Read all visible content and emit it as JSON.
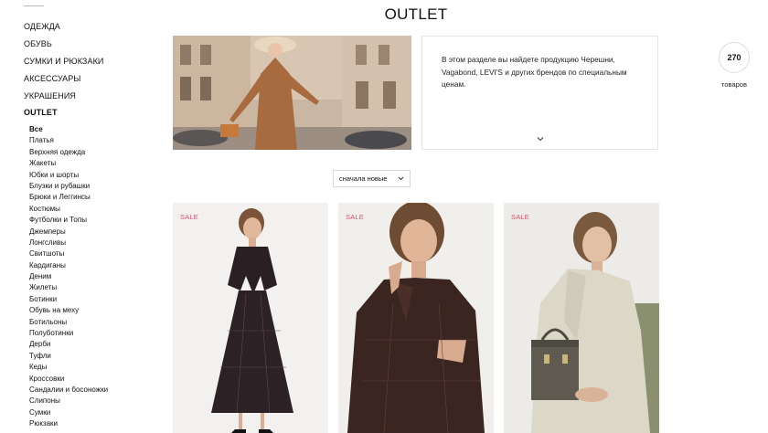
{
  "sidebar": {
    "categories": [
      {
        "label": "ОДЕЖДА"
      },
      {
        "label": "ОБУВЬ"
      },
      {
        "label": "СУМКИ И РЮКЗАКИ"
      },
      {
        "label": "АКСЕССУАРЫ"
      },
      {
        "label": "УКРАШЕНИЯ"
      },
      {
        "label": "OUTLET"
      }
    ],
    "subcategories": [
      "Все",
      "Платья",
      "Верхняя одежда",
      "Жакеты",
      "Юбки и шорты",
      "Блузки и рубашки",
      "Брюки и Леггинсы",
      "Костюмы",
      "Футболки и Топы",
      "Джемперы",
      "Лонгсливы",
      "Свитшоты",
      "Кардиганы",
      "Деним",
      "Жилеты",
      "Ботинки",
      "Обувь на меху",
      "Ботильоны",
      "Полуботинки",
      "Дерби",
      "Туфли",
      "Кеды",
      "Кроссовки",
      "Сандалии и босоножки",
      "Слипоны",
      "Сумки",
      "Рюкзаки"
    ]
  },
  "page": {
    "title": "OUTLET",
    "description": "В этом разделе вы найдете продукцию Черешни, Vagabond, LEVI'S и других брендов по специальным ценам.",
    "count": "270",
    "count_label": "товаров"
  },
  "sort": {
    "selected": "сначала новые"
  },
  "products": [
    {
      "badge": "SALE"
    },
    {
      "badge": "SALE"
    },
    {
      "badge": "SALE"
    }
  ],
  "colors": {
    "sale": "#e0506c",
    "hero_coat": "#a86a3f"
  },
  "icons": [
    "chevron-down-icon",
    "dropdown-arrow-icon"
  ]
}
